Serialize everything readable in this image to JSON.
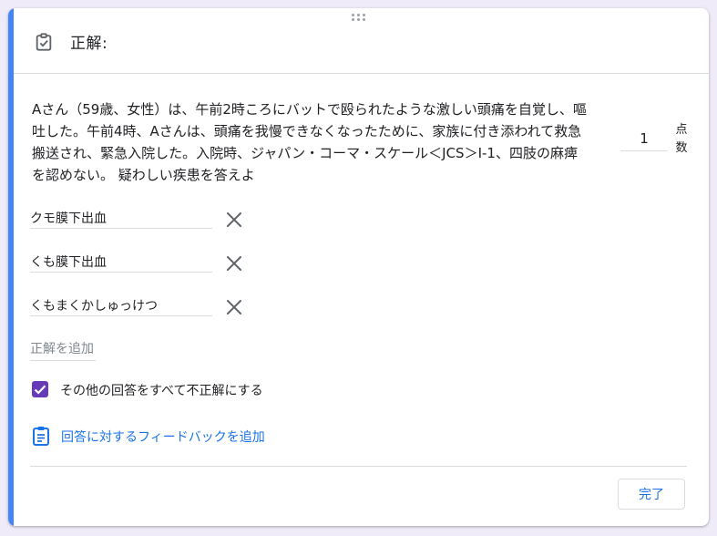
{
  "header": {
    "title": "正解:",
    "icon": "assignment-check-icon"
  },
  "question": {
    "text": "Aさん（59歳、女性）は、午前2時ころにバットで殴られたような激しい頭痛を自覚し、嘔吐した。午前4時、Aさんは、頭痛を我慢できなくなったために、家族に付き添われて救急搬送され、緊急入院した。入院時、ジャパン・コーマ・スケール＜JCS＞Ⅰ-1、四肢の麻痺を認めない。 疑わしい疾患を答えよ"
  },
  "points": {
    "value": "1",
    "label_line1": "点",
    "label_line2": "数"
  },
  "answers": [
    {
      "value": "クモ膜下出血",
      "remove_icon": "close-icon"
    },
    {
      "value": "くも膜下出血",
      "remove_icon": "close-icon"
    },
    {
      "value": "くもまくかしゅっけつ",
      "remove_icon": "close-icon"
    }
  ],
  "add_answer": {
    "placeholder": "正解を追加"
  },
  "mark_incorrect": {
    "label": "その他の回答をすべて不正解にする",
    "checked": true
  },
  "feedback": {
    "label": "回答に対するフィードバックを追加",
    "icon": "feedback-clipboard-icon"
  },
  "done_button": {
    "label": "完了"
  },
  "colors": {
    "accent": "#4285f4",
    "checkbox": "#673ab7",
    "link": "#1a73e8",
    "background": "#f0ebf8"
  }
}
